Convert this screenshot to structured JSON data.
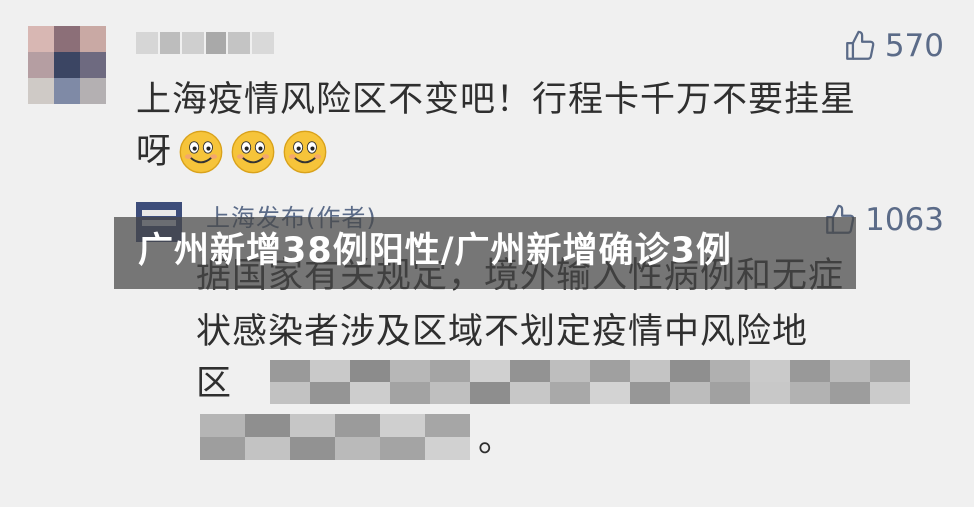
{
  "comments": [
    {
      "text_line1": "上海疫情风险区不变吧！行程卡千万不要挂星",
      "text_line2": "呀",
      "emoji": [
        "smiley-face",
        "smiley-face",
        "smiley-face"
      ],
      "likes": "570"
    },
    {
      "author": "上海发布(作者)",
      "text_line1": "据国家有关规定，境外输入性病例和无症",
      "text_line2": "状感染者涉及区域不划定疫情中风险地",
      "text_line3": "区",
      "text_end": "。",
      "likes": "1063"
    }
  ],
  "banner": {
    "title": "广州新增38例阳性/广州新增确诊3例"
  },
  "colors": {
    "background": "#f0f0f0",
    "text": "#2f2f2f",
    "meta": "#5b6b88",
    "banner_bg": "#464646",
    "banner_text": "#ffffff"
  },
  "icons": [
    "thumbs-up-icon",
    "smiley-emoji-icon"
  ]
}
